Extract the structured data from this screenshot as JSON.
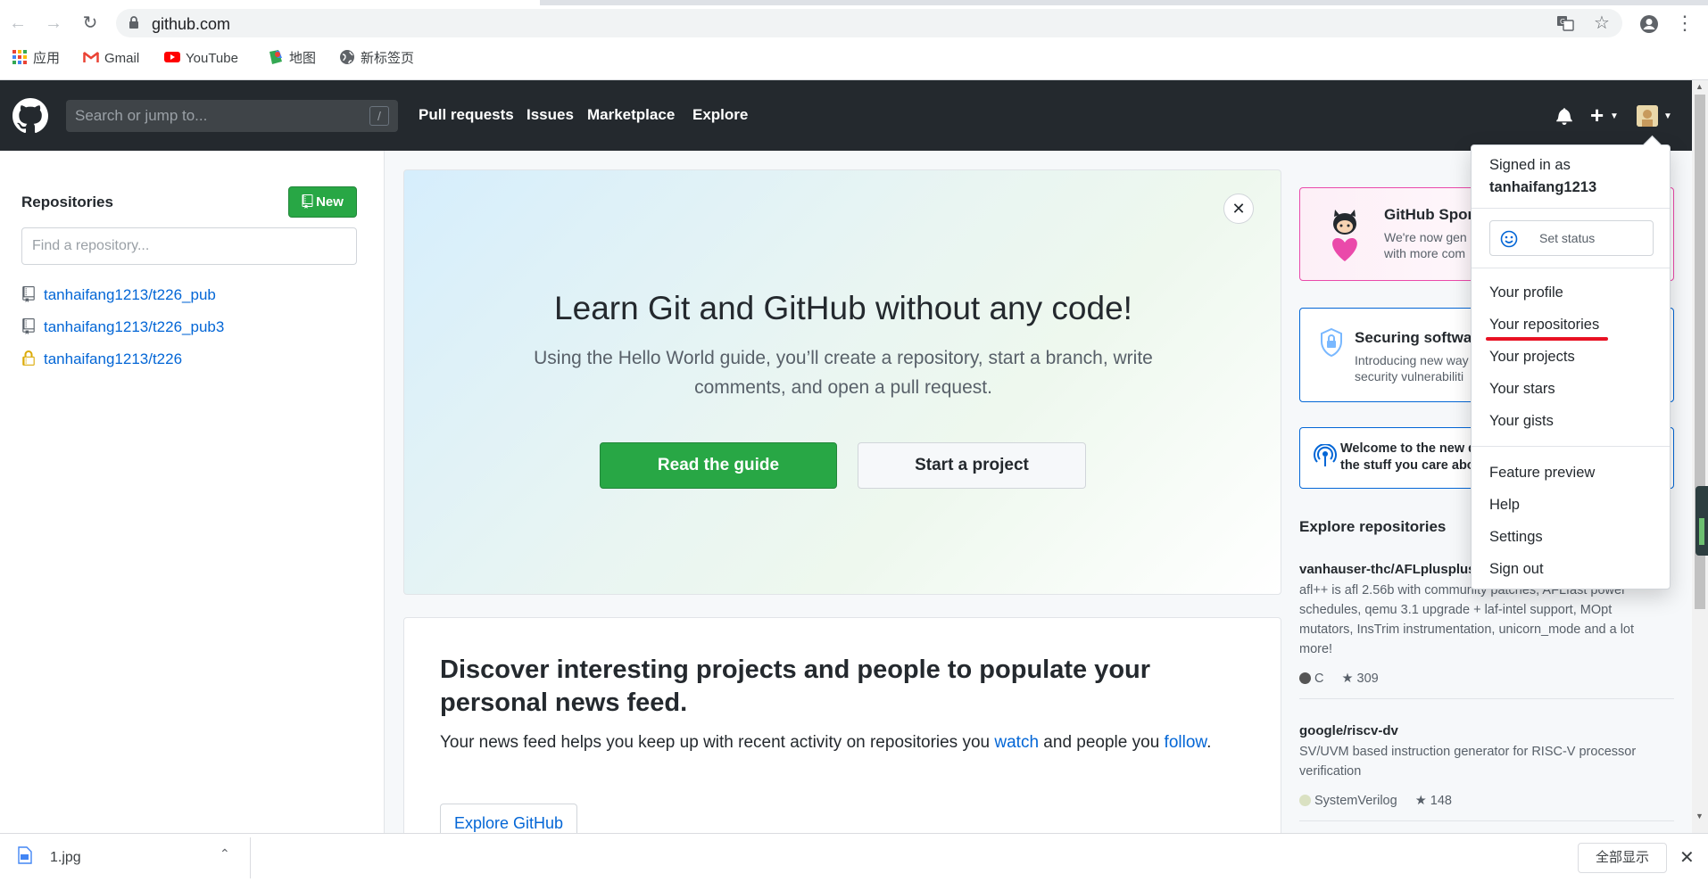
{
  "browser": {
    "url": "github.com",
    "bookmarks": [
      {
        "label": "应用",
        "icon": "apps-grid-icon"
      },
      {
        "label": "Gmail",
        "icon": "gmail-icon"
      },
      {
        "label": "YouTube",
        "icon": "youtube-icon"
      },
      {
        "label": "地图",
        "icon": "maps-icon"
      },
      {
        "label": "新标签页",
        "icon": "globe-icon"
      }
    ]
  },
  "header": {
    "search_placeholder": "Search or jump to...",
    "search_hint": "/",
    "nav": [
      "Pull requests",
      "Issues",
      "Marketplace",
      "Explore"
    ]
  },
  "sidebar": {
    "title": "Repositories",
    "new_label": "New",
    "find_placeholder": "Find a repository...",
    "repos": [
      {
        "name": "tanhaifang1213/t226_pub",
        "private": false
      },
      {
        "name": "tanhaifang1213/t226_pub3",
        "private": false
      },
      {
        "name": "tanhaifang1213/t226",
        "private": true
      }
    ]
  },
  "hero": {
    "title": "Learn Git and GitHub without any code!",
    "subtitle": "Using the Hello World guide, you’ll create a repository, start a branch, write comments, and open a pull request.",
    "primary_label": "Read the guide",
    "secondary_label": "Start a project"
  },
  "discover": {
    "title": "Discover interesting projects and people to populate your personal news feed.",
    "body_pre": "Your news feed helps you keep up with recent activity on repositories you ",
    "link_watch": "watch",
    "body_mid": " and people you ",
    "link_follow": "follow",
    "body_post": ".",
    "button_label": "Explore GitHub"
  },
  "promos": [
    {
      "title": "GitHub Spon",
      "line1": "We're now gen",
      "line2": "with more com"
    },
    {
      "title": "Securing softwar",
      "line1": "Introducing new way",
      "line2": "security vulnerabiliti"
    },
    {
      "title": "",
      "line1": "Welcome to the new d",
      "line2": "the stuff you care abo"
    }
  ],
  "explore": {
    "title": "Explore repositories",
    "repos": [
      {
        "name": "vanhauser-thc/AFLplusplus",
        "description": "afl++ is afl 2.56b with community patches, AFLfast power schedules, qemu 3.1 upgrade + laf-intel support, MOpt mutators, InsTrim instrumentation, unicorn_mode and a lot more!",
        "language": "C",
        "language_color": "#555555",
        "stars": "309"
      },
      {
        "name": "google/riscv-dv",
        "description": "SV/UVM based instruction generator for RISC-V processor verification",
        "language": "SystemVerilog",
        "language_color": "#DAE1C2",
        "stars": "148"
      }
    ]
  },
  "user_menu": {
    "signed_in_as": "Signed in as",
    "username": "tanhaifang1213",
    "set_status": "Set status",
    "items_group1": [
      "Your profile",
      "Your repositories",
      "Your projects",
      "Your stars",
      "Your gists"
    ],
    "items_group2": [
      "Feature preview",
      "Help",
      "Settings",
      "Sign out"
    ]
  },
  "download_bar": {
    "file_name": "1.jpg",
    "show_all": "全部显示"
  },
  "colors": {
    "accent_green": "#28a745",
    "link_blue": "#0366d6",
    "header_dark": "#24292e",
    "highlight_red": "#e81123"
  }
}
